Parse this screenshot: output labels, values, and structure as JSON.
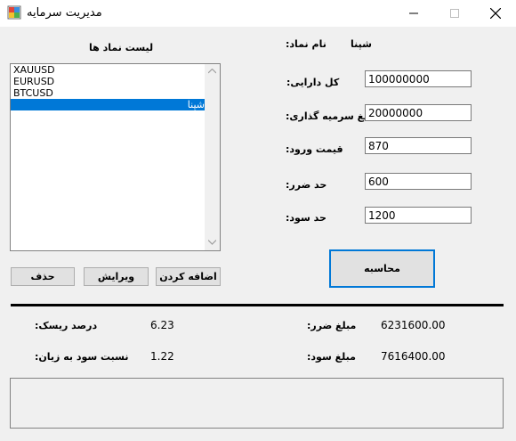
{
  "window": {
    "title": "مدیریت سرمایه"
  },
  "list": {
    "header": "لیست نماد ها",
    "items": [
      "XAUUSD",
      "EURUSD",
      "BTCUSD",
      "شپنا"
    ],
    "selected_index": 3
  },
  "buttons": {
    "delete": "حذف",
    "edit": "ویرایش",
    "add": "اضافه کردن",
    "calculate": "محاسبه"
  },
  "form": {
    "symbol_label": ":نام نماد",
    "symbol_value": "شپنا",
    "total_assets_label": ":کل دارایی",
    "total_assets_value": "100000000",
    "investment_label": ":مبلغ سرمیه گذاری",
    "investment_value": "20000000",
    "entry_price_label": ":قیمت ورود",
    "entry_price_value": "870",
    "stop_loss_label": ":حد ضرر",
    "stop_loss_value": "600",
    "take_profit_label": ":حد سود",
    "take_profit_value": "1200"
  },
  "results": {
    "risk_percent_label": ":درصد ریسک",
    "risk_percent_value": "6.23",
    "reward_risk_label": ":نسبت سود به زیان",
    "reward_risk_value": "1.22",
    "loss_amount_label": ":مبلغ ضرر",
    "loss_amount_value": "6231600.00",
    "profit_amount_label": ":مبلغ سود",
    "profit_amount_value": "7616400.00"
  },
  "colors": {
    "selection": "#0078d7",
    "accent_border": "#0078d7"
  }
}
